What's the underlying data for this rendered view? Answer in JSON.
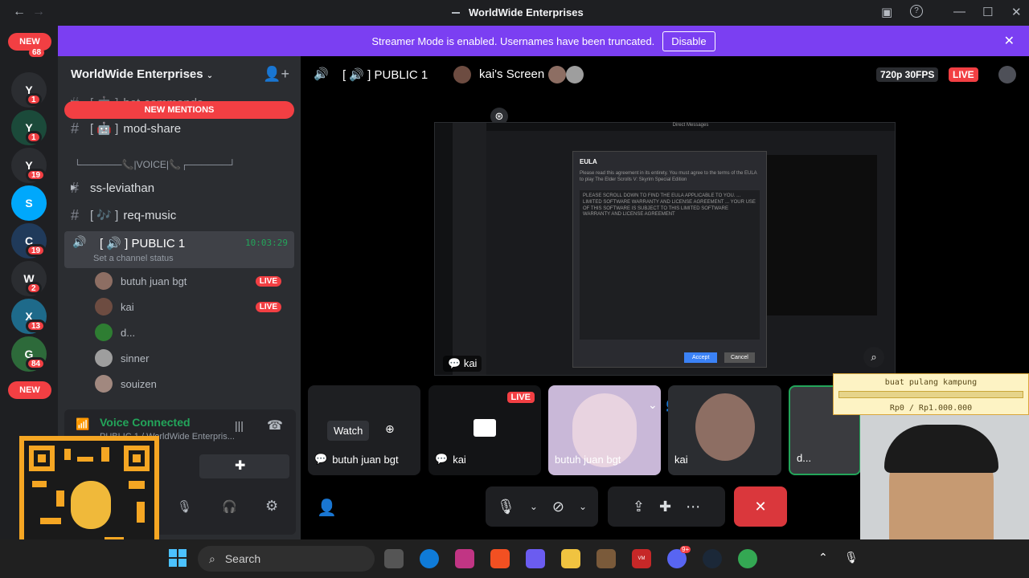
{
  "titlebar": {
    "title": "WorldWide Enterprises"
  },
  "banner": {
    "text": "Streamer Mode is enabled. Usernames have been truncated.",
    "action": "Disable"
  },
  "rail": {
    "new_top": "NEW",
    "new_bottom": "NEW",
    "servers": [
      {
        "label": "Y",
        "badge": "1",
        "color": "#2b2d31"
      },
      {
        "label": "Y",
        "badge": "1",
        "color": "#1b4a3a"
      },
      {
        "label": "Y",
        "badge": "19",
        "color": "#2b2d31"
      },
      {
        "label": "S",
        "badge": "",
        "color": "#00a8fc"
      },
      {
        "label": "C",
        "badge": "19",
        "color": "#203a5a"
      },
      {
        "label": "W",
        "badge": "2",
        "color": "#2b2d31"
      },
      {
        "label": "X",
        "badge": "13",
        "color": "#1e6a8a"
      },
      {
        "label": "G",
        "badge": "84",
        "color": "#2d6a3a"
      }
    ],
    "top_badge": "68"
  },
  "sidebar": {
    "guild_name": "WorldWide Enterprises",
    "new_mentions": "NEW MENTIONS",
    "channels": [
      {
        "prefix": "#",
        "icon": "[ 🤖 ]",
        "name": "bot-commands"
      },
      {
        "prefix": "#",
        "icon": "[ 🤖 ]",
        "name": "mod-share"
      },
      {
        "prefix": "",
        "icon": "",
        "name": "└──────📞|VOICE|📞┌──────┘"
      },
      {
        "prefix": "#",
        "icon": "",
        "name": "ss-leviathan"
      },
      {
        "prefix": "#",
        "icon": "[ 🎶 ]",
        "name": "req-music"
      }
    ],
    "voice_channel": {
      "icon": "[ 🔊 ]",
      "name": "PUBLIC 1",
      "time": "10:03:29",
      "status": "Set a channel status"
    },
    "members": [
      {
        "name": "butuh juan bgt",
        "live": "LIVE"
      },
      {
        "name": "kai",
        "live": "LIVE"
      },
      {
        "name": "d...",
        "live": ""
      },
      {
        "name": "sinner",
        "live": ""
      },
      {
        "name": "souizen",
        "live": ""
      }
    ],
    "voice_connected": "Voice Connected",
    "voice_sub": "PUBLIC 1 / WorldWide Enterpris..."
  },
  "stage": {
    "channel": "[ 🔊 ] PUBLIC 1",
    "screen_title": "kai's Screen",
    "quality": "720p 30FPS",
    "live": "LIVE",
    "streamer_label": "kai",
    "eula_title": "EULA",
    "eula_intro": "Please read this agreement in its entirety. You must agree to the terms of the EULA to play The Elder Scrolls V: Skyrim Special Edition",
    "eula_body": "PLEASE SCROLL DOWN TO FIND THE EULA APPLICABLE TO YOU. ... LIMITED SOFTWARE WARRANTY AND LICENSE AGREEMENT ... YOUR USE OF THIS SOFTWARE IS SUBJECT TO THIS LIMITED SOFTWARE WARRANTY AND LICENSE AGREEMENT",
    "eula_accept": "Accept",
    "eula_cancel": "Cancel",
    "screen_window": "Direct Messages",
    "tiles": [
      {
        "name": "butuh juan bgt",
        "extra": "Watch"
      },
      {
        "name": "kai",
        "extra": "LIVE"
      },
      {
        "name": "butuh juan bgt",
        "extra": ""
      },
      {
        "name": "kai",
        "extra": ""
      },
      {
        "name": "d...",
        "extra": ""
      }
    ]
  },
  "donation": {
    "title": "buat pulang kampung",
    "progress": "Rp0 / Rp1.000.000",
    "fraction": 0
  },
  "taskbar": {
    "search": "Search",
    "discord_badge": "9+"
  },
  "colors": {
    "accent": "#5865f2",
    "live": "#f23f43",
    "banner": "#7b3ff2",
    "green": "#23a55a"
  }
}
